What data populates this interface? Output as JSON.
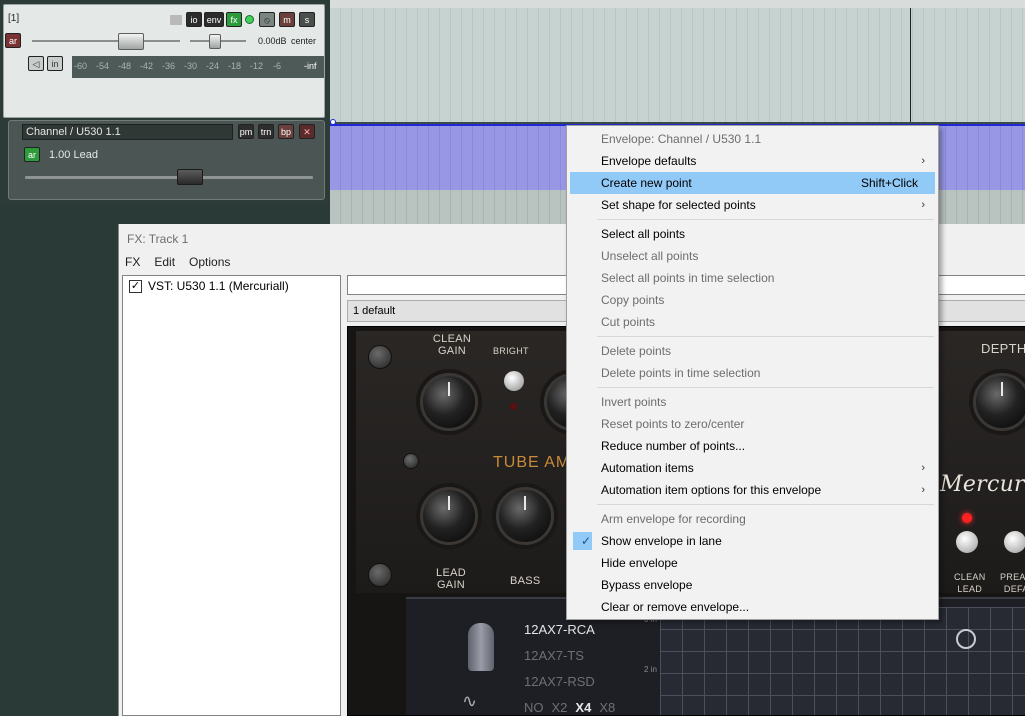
{
  "track_panel": {
    "track_number": "[1]",
    "btn_io": "io",
    "btn_env": "env",
    "btn_fx": "fx",
    "btn_m": "m",
    "btn_s": "s",
    "btn_ar": "ar",
    "volume_readout": "0.00dB",
    "pan_readout": "center",
    "btn_in": "in",
    "meter_ticks": [
      "-60",
      "-54",
      "-48",
      "-42",
      "-36",
      "-30",
      "-24",
      "-18",
      "-12",
      "-6",
      "-inf"
    ]
  },
  "envelope_panel": {
    "name": "Channel / U530 1.1",
    "btn_pm": "pm",
    "btn_trn": "trn",
    "btn_bp": "bp",
    "btn_ar": "ar",
    "value": "1.00 Lead",
    "fader_level": 0.58
  },
  "fx_window": {
    "title": "FX: Track 1",
    "menu": [
      "FX",
      "Edit",
      "Options"
    ],
    "chain": [
      {
        "checked": true,
        "name": "VST: U530 1.1 (Mercuriall)"
      }
    ],
    "preset": "1 default"
  },
  "plugin": {
    "labels": {
      "clean_gain": "CLEAN\nGAIN",
      "bright": "BRIGHT",
      "tube_amp": "TUBE AM",
      "lead_gain": "LEAD\nGAIN",
      "bass": "BASS",
      "depth": "DEPTH",
      "brand": "Mercuriall",
      "clean_lead": "CLEAN\nLEAD",
      "preamp_default": "PREAN\nDEFA",
      "grid_0in": "0 in",
      "grid_2in": "2 in"
    },
    "tubes": [
      "12AX7-RCA",
      "12AX7-TS",
      "12AX7-RSD"
    ],
    "oversampling": [
      "NO",
      "X2",
      "X4",
      "X8"
    ],
    "oversampling_selected": "X4"
  },
  "context_menu": {
    "items": [
      {
        "label": "Envelope: Channel / U530 1.1",
        "disabled": true
      },
      {
        "label": "Envelope defaults",
        "submenu": true
      },
      {
        "label": "Create new point",
        "shortcut": "Shift+Click",
        "highlighted": true
      },
      {
        "label": "Set shape for selected points",
        "submenu": true
      },
      {
        "separator": true
      },
      {
        "label": "Select all points"
      },
      {
        "label": "Unselect all points",
        "disabled": true
      },
      {
        "label": "Select all points in time selection",
        "disabled": true
      },
      {
        "label": "Copy points",
        "disabled": true
      },
      {
        "label": "Cut points",
        "disabled": true
      },
      {
        "separator": true
      },
      {
        "label": "Delete points",
        "disabled": true
      },
      {
        "label": "Delete points in time selection",
        "disabled": true
      },
      {
        "separator": true
      },
      {
        "label": "Invert points",
        "disabled": true
      },
      {
        "label": "Reset points to zero/center",
        "disabled": true
      },
      {
        "label": "Reduce number of points..."
      },
      {
        "label": "Automation items",
        "submenu": true
      },
      {
        "label": "Automation item options for this envelope",
        "submenu": true
      },
      {
        "separator": true
      },
      {
        "label": "Arm envelope for recording",
        "disabled": true
      },
      {
        "label": "Show envelope in lane",
        "checked": true
      },
      {
        "label": "Hide envelope"
      },
      {
        "label": "Bypass envelope"
      },
      {
        "label": "Clear or remove envelope..."
      }
    ]
  },
  "colors": {
    "menu_highlight": "#91c9f7",
    "envelope_lane": "#9797e5",
    "envelope_line": "#1e2ad8",
    "fx_button": "#2d9b3c"
  }
}
